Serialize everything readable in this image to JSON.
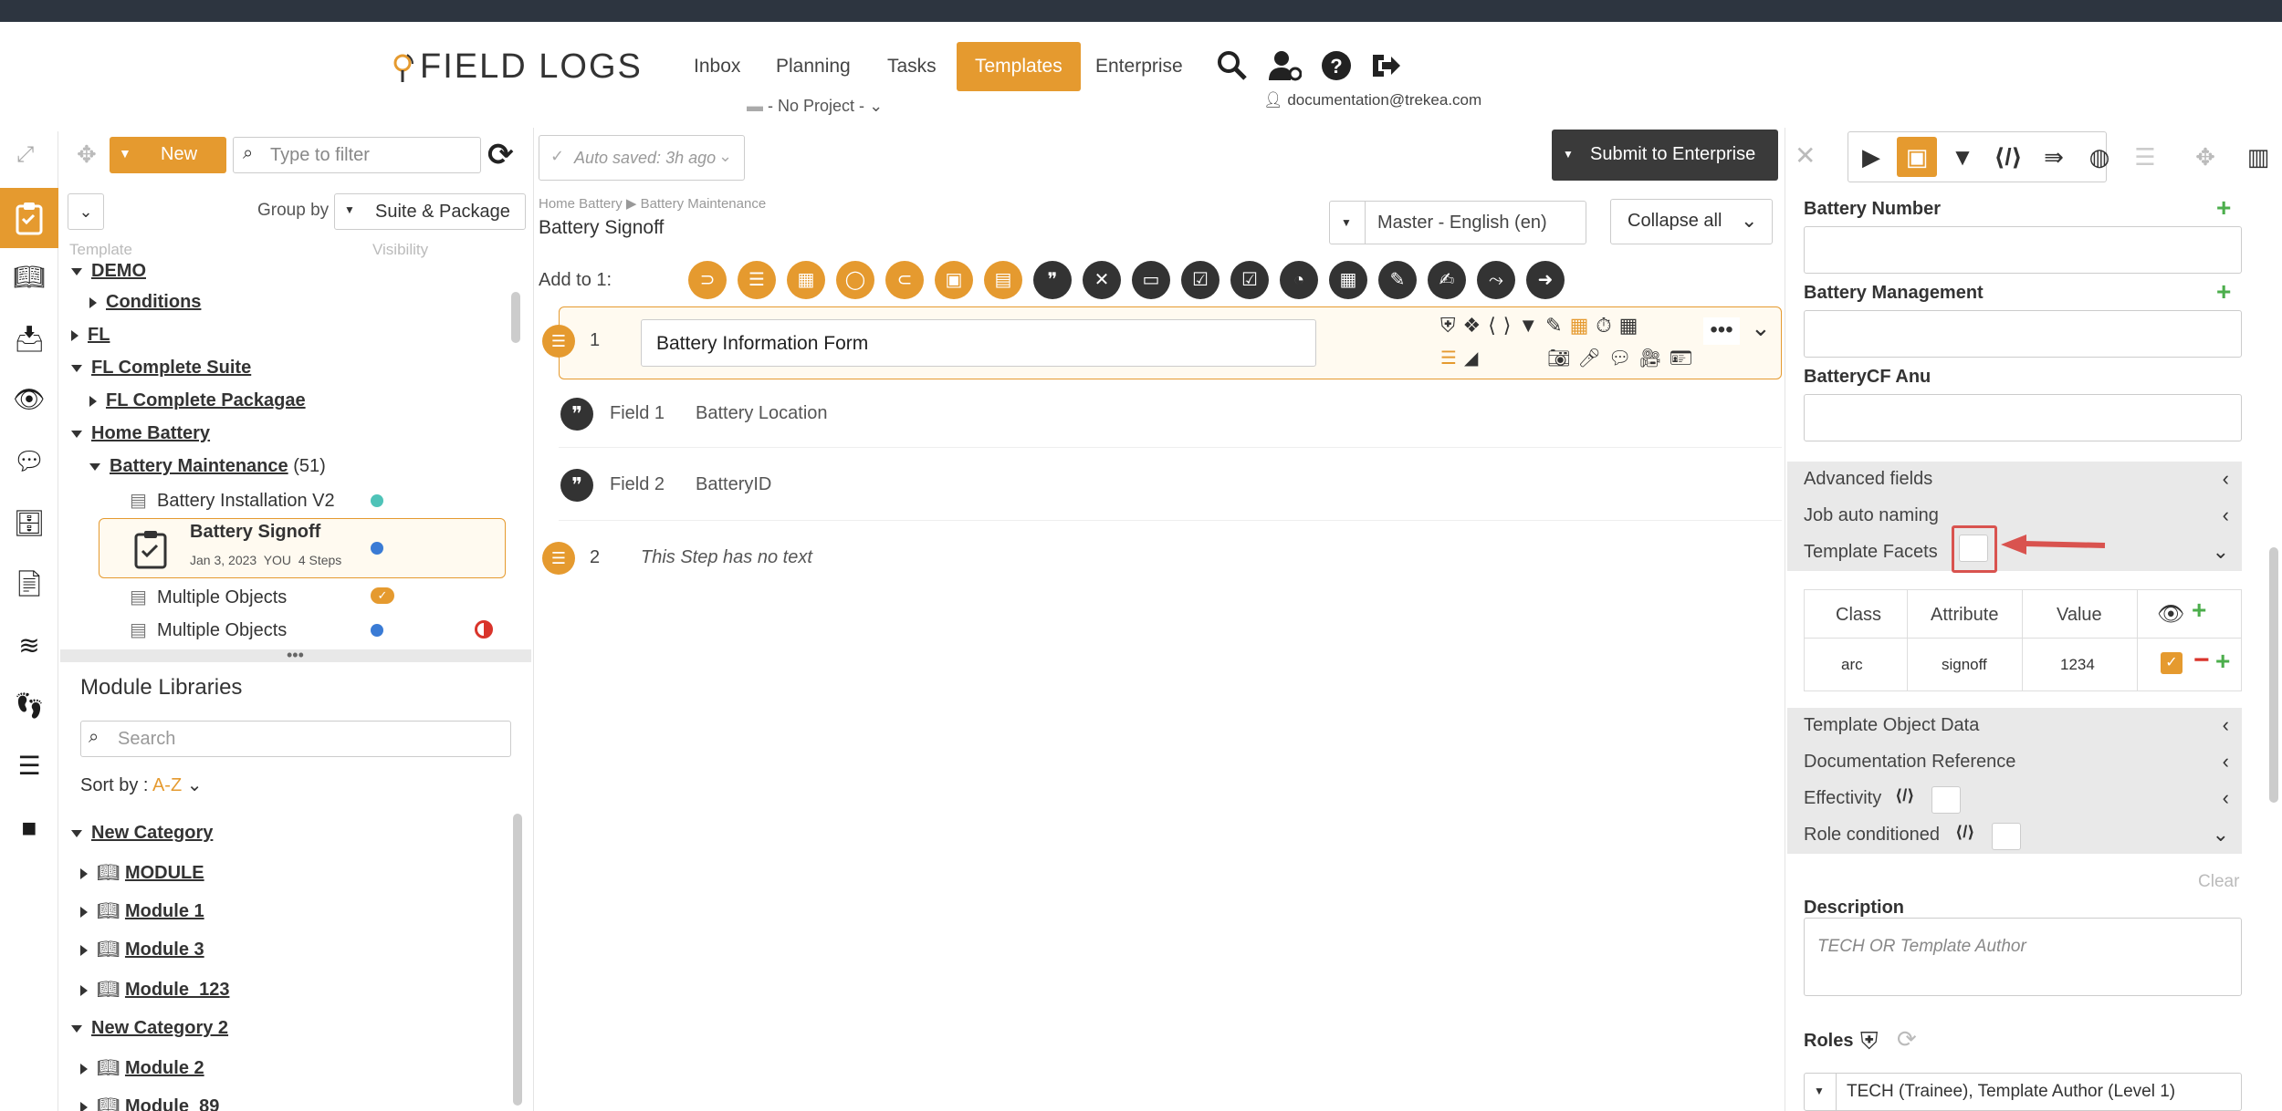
{
  "app": {
    "logo_text": "FIELD LOGS"
  },
  "nav": {
    "items": [
      "Inbox",
      "Planning",
      "Tasks",
      "Templates",
      "Enterprise"
    ],
    "active": "Templates",
    "project": "- No Project -",
    "user": "documentation@trekea.com"
  },
  "template_panel": {
    "new_label": "New",
    "filter_placeholder": "Type to filter",
    "group_by_label": "Group by",
    "group_by_value": "Suite & Package",
    "col_template": "Template",
    "col_visibility": "Visibility",
    "tree": [
      {
        "label": "DEMO",
        "level": 0
      },
      {
        "label": "Conditions",
        "level": 1
      },
      {
        "label": "FL",
        "level": 0
      },
      {
        "label": "FL Complete Suite",
        "level": 0
      },
      {
        "label": "FL Complete Packagae",
        "level": 1
      },
      {
        "label": "Home Battery",
        "level": 0
      },
      {
        "label": "Battery Maintenance",
        "count": "(51)",
        "level": 1
      },
      {
        "label": "Battery Installation V2",
        "level": 2
      },
      {
        "label": "Battery Signoff",
        "meta": "Jan 3, 2023  YOU  4 Steps",
        "level": 2
      },
      {
        "label": "Multiple Objects",
        "level": 2
      },
      {
        "label": "Multiple Objects",
        "level": 2
      }
    ],
    "colors": {
      "teal": "#4fc3b8",
      "blue": "#3a7bd5",
      "orange": "#e59a2f",
      "red": "#d9342b"
    }
  },
  "modules": {
    "title": "Module Libraries",
    "search_placeholder": "Search",
    "sort_label": "Sort by :",
    "sort_value": "A-Z",
    "tree": [
      {
        "label": "New Category",
        "level": 0
      },
      {
        "label": "MODULE",
        "level": 1
      },
      {
        "label": "Module 1",
        "level": 1
      },
      {
        "label": "Module 3",
        "level": 1
      },
      {
        "label": "Module_123",
        "level": 1
      },
      {
        "label": "New Category 2",
        "level": 0
      },
      {
        "label": "Module 2",
        "level": 1
      },
      {
        "label": "Module_89",
        "level": 1
      }
    ]
  },
  "editor": {
    "autosave": "Auto saved: 3h ago",
    "submit_label": "Submit to Enterprise",
    "breadcrumb_1": "Home Battery",
    "breadcrumb_2": "Battery Maintenance",
    "title": "Battery Signoff",
    "language": "Master - English (en)",
    "collapse_label": "Collapse all",
    "add_to_label": "Add to 1:",
    "steps": [
      {
        "num": "1",
        "text": "Battery Information Form"
      },
      {
        "num": "2",
        "text": "This Step has no text"
      }
    ],
    "fields": [
      {
        "label": "Field 1",
        "value": "Battery Location"
      },
      {
        "label": "Field 2",
        "value": "BatteryID"
      }
    ]
  },
  "right_panel": {
    "battery_number": "Battery Number",
    "battery_management": "Battery Management",
    "batterycf": "BatteryCF Anu",
    "advanced": "Advanced fields",
    "job_naming": "Job auto naming",
    "facets": "Template Facets",
    "facet_headers": [
      "Class",
      "Attribute",
      "Value"
    ],
    "facet_row": [
      "arc",
      "signoff",
      "1234"
    ],
    "object_data": "Template Object Data",
    "doc_ref": "Documentation Reference",
    "effectivity": "Effectivity",
    "role_conditioned": "Role conditioned",
    "clear": "Clear",
    "description_label": "Description",
    "description_placeholder": "TECH OR Template Author",
    "roles_label": "Roles",
    "roles_value": "TECH (Trainee), Template Author (Level 1)"
  }
}
